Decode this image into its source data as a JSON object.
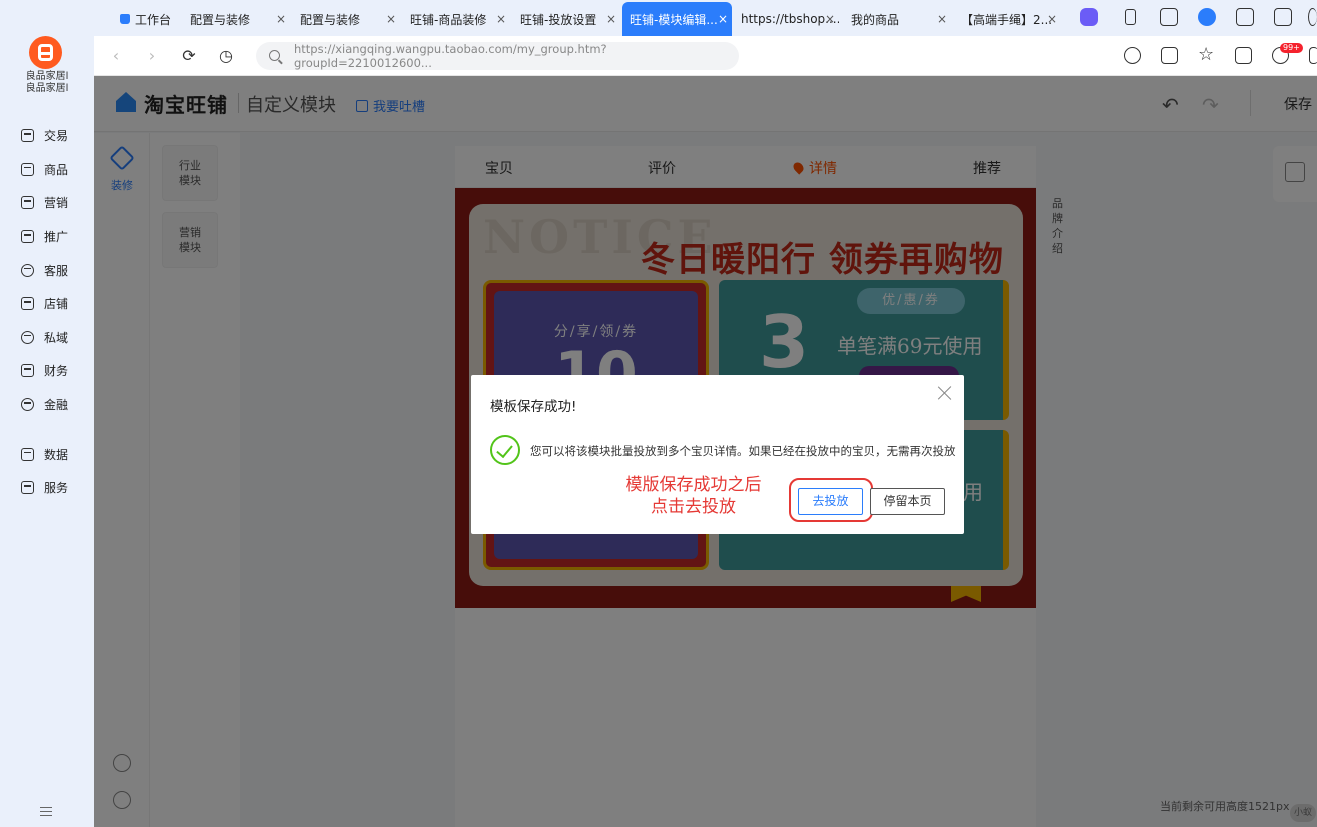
{
  "shop": {
    "name_line1": "良品家居l",
    "name_line2": "良品家居l"
  },
  "sidebar": {
    "items": [
      {
        "label": "交易"
      },
      {
        "label": "商品"
      },
      {
        "label": "营销"
      },
      {
        "label": "推广"
      },
      {
        "label": "客服"
      },
      {
        "label": "店铺"
      },
      {
        "label": "私域"
      },
      {
        "label": "财务"
      },
      {
        "label": "金融"
      },
      {
        "label": "数据"
      },
      {
        "label": "服务"
      }
    ]
  },
  "tabs": [
    {
      "label": "工作台"
    },
    {
      "label": "配置与装修"
    },
    {
      "label": "配置与装修"
    },
    {
      "label": "旺铺-商品装修"
    },
    {
      "label": "旺铺-投放设置"
    },
    {
      "label": "旺铺-模块编辑..."
    },
    {
      "label": "https://tbshop...."
    },
    {
      "label": "我的商品"
    },
    {
      "label": "【高端手绳】2..."
    }
  ],
  "close_glyph": "×",
  "address": {
    "url": "https://xiangqing.wangpu.taobao.com/my_group.htm?groupId=2210012600..."
  },
  "notification_badge": "99+",
  "editor": {
    "logo_text": "淘宝旺铺",
    "subtitle": "自定义模块",
    "feedback": "我要吐槽",
    "save": "保存",
    "undo_glyph": "↶",
    "redo_glyph": "↷",
    "decorate_label": "装修",
    "modules": [
      "行业模块",
      "营销模块"
    ],
    "canvas_tabs": [
      "宝贝",
      "评价",
      "详情",
      "推荐"
    ],
    "side_label": "品牌介绍",
    "height_info": "当前剩余可用高度1521px",
    "mini_button": "小蚁"
  },
  "banner": {
    "notice_word": "NOTICE",
    "title": "冬日暖阳行 领券再购物",
    "left_caption": "分/享/领/券",
    "left_big": "10",
    "right_tag": "优/惠/券",
    "right_big": "3",
    "right_text": "单笔满69元使用",
    "right_text2": "用"
  },
  "modal": {
    "title": "模板保存成功!",
    "message": "您可以将该模块批量投放到多个宝贝详情。如果已经在投放中的宝贝，无需再次投放",
    "primary_button": "去投放",
    "secondary_button": "停留本页",
    "annotation_line1": "模版保存成功之后",
    "annotation_line2": "点击去投放",
    "annotation_color": "#e53935",
    "accent_color": "#2b7dfb",
    "success_color": "#52c41a"
  }
}
